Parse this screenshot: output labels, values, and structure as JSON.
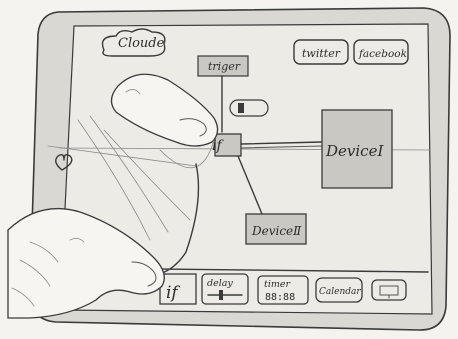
{
  "header": {
    "cloud_label": "Cloude",
    "twitter_label": "twitter",
    "facebook_label": "facebook"
  },
  "canvas": {
    "trigger_label": "triger",
    "if_node_label": "if",
    "device1_label": "DeviceⅠ",
    "device2_label": "DeviceⅡ"
  },
  "toolbar": {
    "if_label": "if",
    "delay_label": "delay",
    "timer_label": "timer",
    "timer_value": "88:88",
    "calendar_label": "Calendar"
  },
  "colors": {
    "paper": "#f4f3ef",
    "tablet_shade": "#d9d8d3",
    "screen": "#ecebe6",
    "node_fill": "#c9c8c3",
    "pencil": "#3a3a3a"
  }
}
